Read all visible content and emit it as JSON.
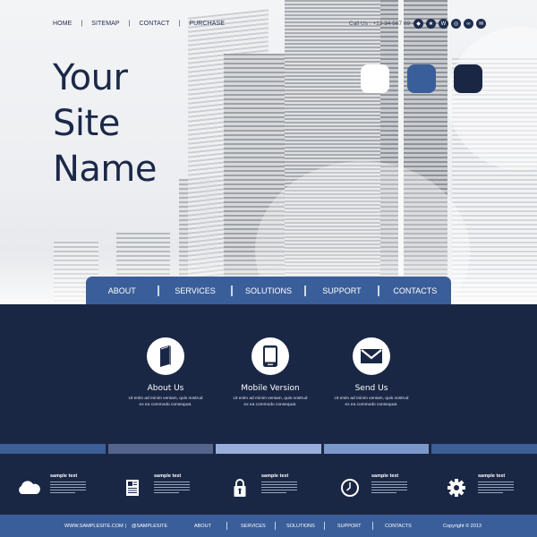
{
  "header": {
    "top_nav": [
      "HOME",
      "SITEMAP",
      "CONTACT",
      "PURCHASE"
    ],
    "contact": "Call Us : +12 34 567 89",
    "social_icons": [
      "bag-icon",
      "star-icon",
      "w-icon",
      "share-icon",
      "cs-icon",
      "mail-icon"
    ],
    "social_glyphs": [
      "◆",
      "★",
      "W",
      "◎",
      "∞",
      "✉"
    ],
    "site_name": [
      "Your",
      "Site",
      "Name"
    ],
    "swatches": [
      "#ffffff",
      "#3a5e99",
      "#1a2744"
    ]
  },
  "main_nav": [
    "ABOUT",
    "SERVICES",
    "SOLUTIONS",
    "SUPPORT",
    "CONTACTS"
  ],
  "services": [
    {
      "icon": "book-icon",
      "title": "About Us",
      "desc_line1": "Ut enim ad minim veniam, quis nostrud",
      "desc_line2": "ex ea commodo consequat."
    },
    {
      "icon": "tablet-icon",
      "title": "Mobile Version",
      "desc_line1": "Ut enim ad minim veniam, quis nostrud",
      "desc_line2": "ex ea commodo consequat."
    },
    {
      "icon": "envelope-icon",
      "title": "Send Us",
      "desc_line1": "Ut enim ad minim veniam, quis nostrud",
      "desc_line2": "ex ea commodo consequat."
    }
  ],
  "strip_colors": [
    "#3d5e96",
    "#56638a",
    "#9aaedb",
    "#7b98cb",
    "#3d5e96"
  ],
  "features": [
    {
      "icon": "cloud-icon",
      "title": "sample text"
    },
    {
      "icon": "document-icon",
      "title": "sample text"
    },
    {
      "icon": "lock-icon",
      "title": "sample text"
    },
    {
      "icon": "clock-icon",
      "title": "sample text"
    },
    {
      "icon": "gear-icon",
      "title": "sample text"
    }
  ],
  "footer": {
    "website": "WWW.SAMPLESITE.COM",
    "handle": "@SAMPLESITE",
    "links": [
      "ABOUT",
      "SERVICES",
      "SOLUTIONS",
      "SUPPORT",
      "CONTACTS"
    ],
    "copyright": "Copyright © 2013"
  }
}
